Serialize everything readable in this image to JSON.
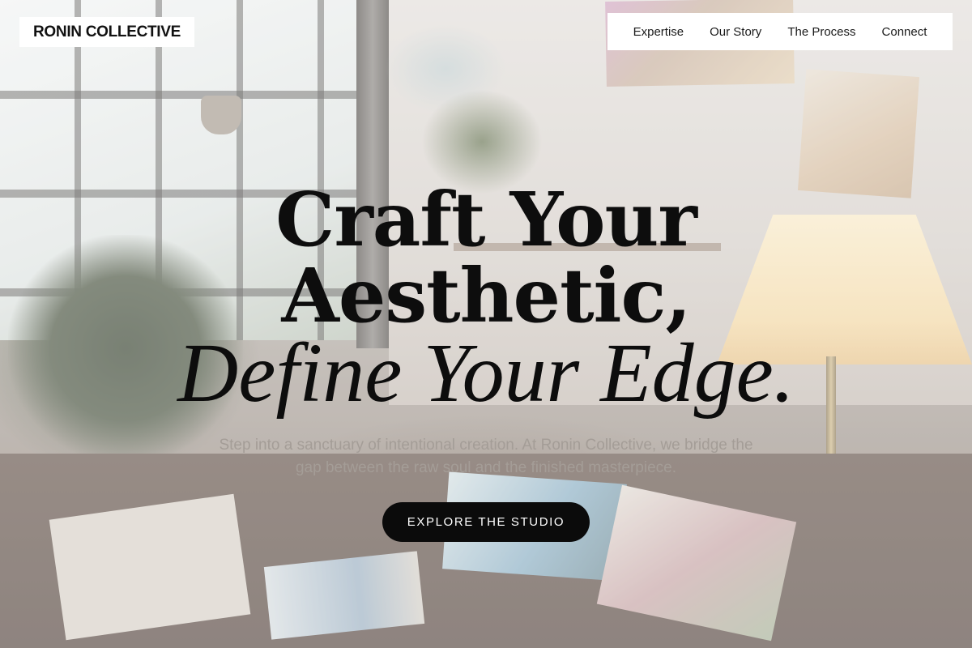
{
  "brand": {
    "logo_text": "RONIN COLLECTIVE"
  },
  "nav": {
    "items": [
      {
        "label": "Expertise"
      },
      {
        "label": "Our Story"
      },
      {
        "label": "The Process"
      },
      {
        "label": "Connect"
      }
    ]
  },
  "hero": {
    "headline_line1": "Craft Your",
    "headline_line2": "Aesthetic,",
    "headline_line3": "Define Your Edge.",
    "subtitle": "Step into a sanctuary of intentional creation. At Ronin Collective, we bridge the gap between the raw soul and the finished masterpiece.",
    "cta_label": "EXPLORE THE STUDIO"
  },
  "colors": {
    "text_dark": "#0d0d0d",
    "button_bg": "#0b0b0b",
    "button_text": "#ffffff",
    "subtitle_text": "#a49d97",
    "header_bg": "#ffffff"
  }
}
